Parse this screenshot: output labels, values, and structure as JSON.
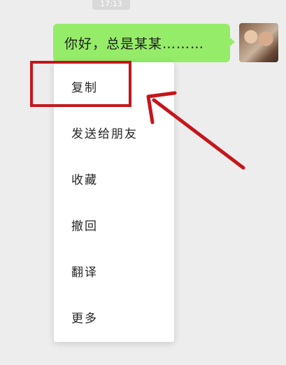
{
  "status": {
    "time": "17:13"
  },
  "chat": {
    "message": "你好，总是某某………"
  },
  "menu": {
    "items": [
      "复制",
      "发送给朋友",
      "收藏",
      "撤回",
      "翻译",
      "更多"
    ]
  },
  "colors": {
    "background": "#ededed",
    "bubble": "#95ec69",
    "menu": "#ffffff",
    "annotation": "#c4161c"
  }
}
